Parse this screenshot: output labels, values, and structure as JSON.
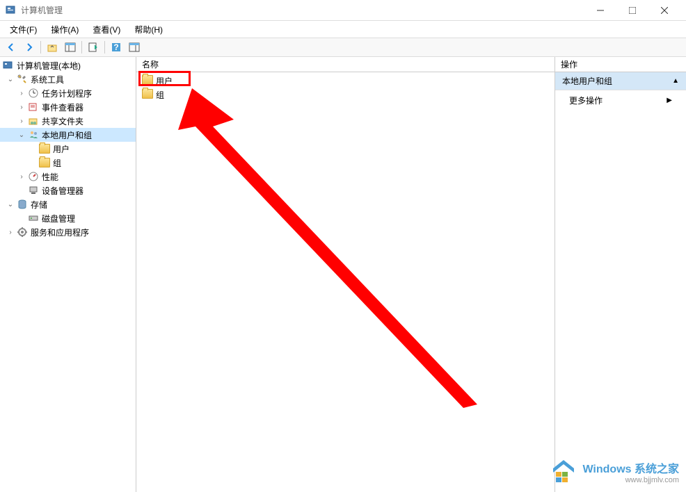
{
  "window": {
    "title": "计算机管理"
  },
  "menubar": {
    "file": "文件(F)",
    "action": "操作(A)",
    "view": "查看(V)",
    "help": "帮助(H)"
  },
  "tree": {
    "root": "计算机管理(本地)",
    "system_tools": "系统工具",
    "task_scheduler": "任务计划程序",
    "event_viewer": "事件查看器",
    "shared_folders": "共享文件夹",
    "local_users_groups": "本地用户和组",
    "users": "用户",
    "groups": "组",
    "performance": "性能",
    "device_manager": "设备管理器",
    "storage": "存储",
    "disk_management": "磁盘管理",
    "services_apps": "服务和应用程序"
  },
  "content": {
    "header_name": "名称",
    "items": {
      "users": "用户",
      "groups": "组"
    }
  },
  "actions": {
    "header": "操作",
    "section_title": "本地用户和组",
    "more_actions": "更多操作"
  },
  "watermark": {
    "title": "Windows 系统之家",
    "url": "www.bjjmlv.com"
  }
}
